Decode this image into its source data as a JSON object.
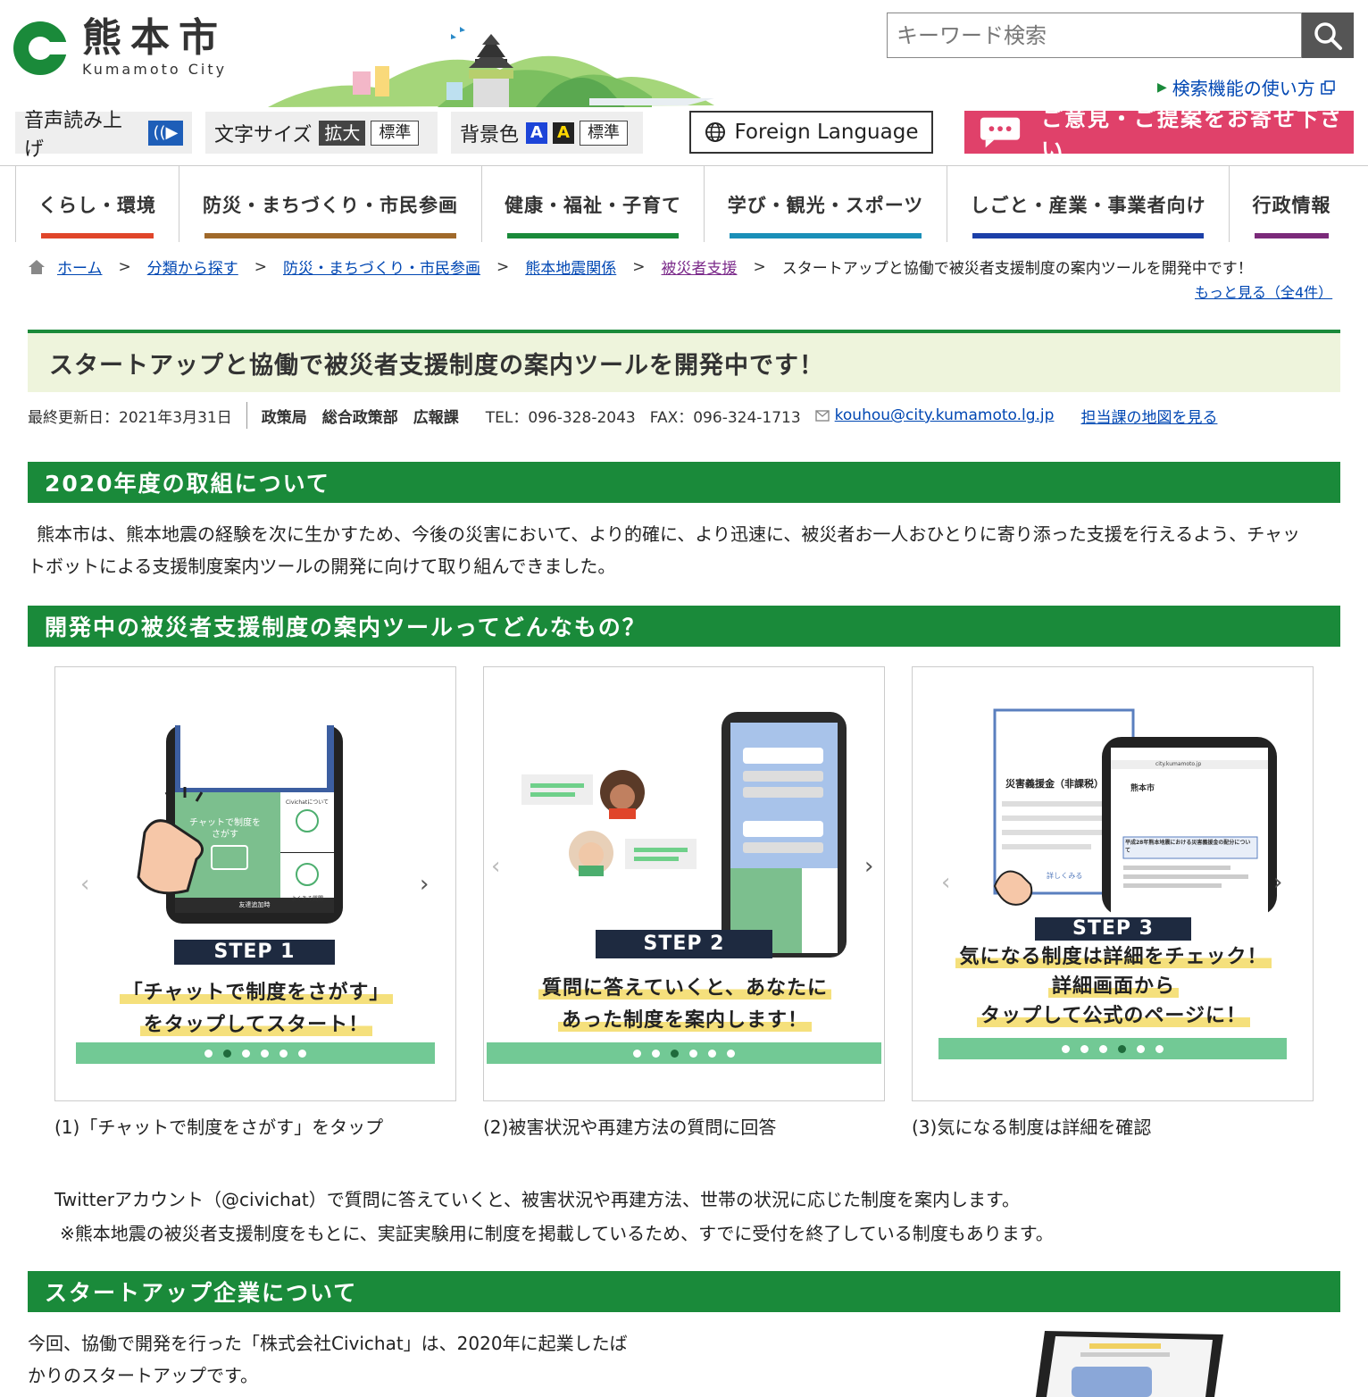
{
  "header": {
    "logo_ja": "熊本市",
    "logo_en": "Kumamoto City",
    "search_placeholder": "キーワード検索",
    "search_help": "検索機能の使い方"
  },
  "toolbar": {
    "voice_label": "音声読み上げ",
    "size_label": "文字サイズ",
    "size_large": "拡大",
    "size_normal": "標準",
    "bg_label": "背景色",
    "bg_a1": "A",
    "bg_a2": "A",
    "bg_normal": "標準",
    "foreign": "Foreign Language",
    "opinion": "ご意見・ご提案をお寄せ下さい"
  },
  "gnav": [
    {
      "label": "くらし・環境",
      "color": "#e0452a"
    },
    {
      "label": "防災・まちづくり・市民参画",
      "color": "#a0692a"
    },
    {
      "label": "健康・福祉・子育て",
      "color": "#1a8a3a"
    },
    {
      "label": "学び・観光・スポーツ",
      "color": "#1a8fb8"
    },
    {
      "label": "しごと・産業・事業者向け",
      "color": "#1c3fa8"
    },
    {
      "label": "行政情報",
      "color": "#7b2a7a"
    }
  ],
  "breadcrumb": {
    "items": [
      "ホーム",
      "分類から探す",
      "防災・まちづくり・市民参画",
      "熊本地震関係",
      "被災者支援"
    ],
    "current": "スタートアップと協働で被災者支援制度の案内ツールを開発中です！",
    "sep": ">",
    "more": "もっと見る（全4件）"
  },
  "page": {
    "title": "スタートアップと協働で被災者支援制度の案内ツールを開発中です！",
    "updated": "最終更新日：2021年3月31日",
    "dept": "政策局　総合政策部　広報課",
    "tel": "TEL：096-328-2043",
    "fax": "FAX：096-324-1713",
    "email": "kouhou@city.kumamoto.lg.jp",
    "map_link": "担当課の地図を見る"
  },
  "sections": [
    {
      "heading": "2020年度の取組について",
      "body": "熊本市は、熊本地震の経験を次に生かすため、今後の災害において、より的確に、より迅速に、被災者お一人おひとりに寄り添った支援を行えるよう、チャットボットによる支援制度案内ツールの開発に向けて取り組んできました。"
    },
    {
      "heading": "開発中の被災者支援制度の案内ツールってどんなもの？",
      "body1": "Twitterアカウント（@civichat）で質問に答えていくと、被害状況や再建方法、世帯の状況に応じた制度を案内します。",
      "body2": "※熊本地震の被災者支援制度をもとに、実証実験用に制度を掲載しているため、すでに受付を終了している制度もあります。"
    },
    {
      "heading": "スタートアップ企業について",
      "body": "今回、協働で開発を行った「株式会社Civichat」は、2020年に起業したばかりのスタートアップです。"
    }
  ],
  "figures": [
    {
      "step": "STEP 1",
      "line1": "「チャットで制度をさがす」",
      "line2": "をタップしてスタート！",
      "phone_btn": "チャットで制度をさがす",
      "phone_side1": "Civichatについて",
      "phone_side2": "よくある質問",
      "phone_footer": "友達追加時",
      "caption": "(1)「チャットで制度をさがす」をタップ",
      "active_dot": 2
    },
    {
      "step": "STEP 2",
      "line1": "質問に答えていくと、あなたに",
      "line2": "あった制度を案内します！",
      "caption": "(2)被害状況や再建方法の質問に回答",
      "active_dot": 3
    },
    {
      "step": "STEP 3",
      "line1": "気になる制度は詳細をチェック！",
      "line2": "詳細画面から",
      "line3": "タップして公式のページに！",
      "doc_title": "災害義援金（非課税）",
      "doc_more": "詳しくみる",
      "phone_url": "city.kumamoto.jp",
      "phone_logo": "熊本市",
      "phone_heading": "平成28年熊本地震における災害義援金の配分について",
      "caption": "(3)気になる制度は詳細を確認",
      "active_dot": 4
    }
  ],
  "colors": {
    "brand_green": "#1a8a3a",
    "title_bg": "#eef4dc",
    "link": "#0047b3",
    "opinion": "#e0416a"
  }
}
